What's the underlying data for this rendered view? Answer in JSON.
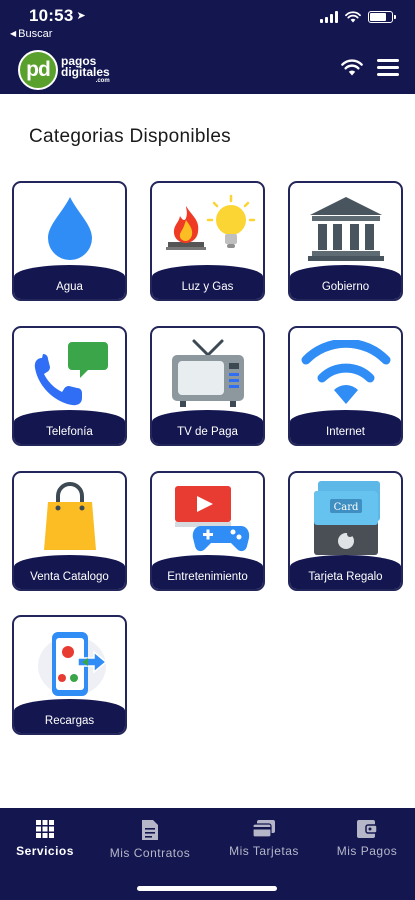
{
  "status_bar": {
    "time": "10:53",
    "location_arrow": "➤"
  },
  "header": {
    "back_label": "Buscar",
    "logo_mark": "pd",
    "logo_line1": "pagos",
    "logo_line2": "digitales",
    "logo_line3": ".com",
    "wifi_icon": "wifi-icon",
    "menu_icon": "hamburger-icon"
  },
  "page": {
    "title": "Categorias Disponibles"
  },
  "categories": [
    {
      "label": "Agua",
      "icon": "water-drop-icon"
    },
    {
      "label": "Luz y Gas",
      "icon": "fire-and-bulb-icon"
    },
    {
      "label": "Gobierno",
      "icon": "government-building-icon"
    },
    {
      "label": "Telefonía",
      "icon": "phone-chat-icon"
    },
    {
      "label": "TV de Paga",
      "icon": "tv-icon"
    },
    {
      "label": "Internet",
      "icon": "wifi-icon"
    },
    {
      "label": "Venta Catalogo",
      "icon": "shopping-bag-icon"
    },
    {
      "label": "Entretenimiento",
      "icon": "video-gamepad-icon"
    },
    {
      "label": "Tarjeta Regalo",
      "icon": "gift-card-icon",
      "card_text": "Card"
    },
    {
      "label": "Recargas",
      "icon": "phone-recharge-icon"
    }
  ],
  "bottom_nav": [
    {
      "label": "Servicios",
      "icon": "grid-icon",
      "active": true
    },
    {
      "label": "Mis Contratos",
      "icon": "document-icon",
      "active": false
    },
    {
      "label": "Mis Tarjetas",
      "icon": "cards-icon",
      "active": false
    },
    {
      "label": "Mis Pagos",
      "icon": "wallet-icon",
      "active": false
    }
  ],
  "colors": {
    "navy": "#141650",
    "green_logo": "#5aa02c",
    "blue_icon": "#2f8df5"
  }
}
